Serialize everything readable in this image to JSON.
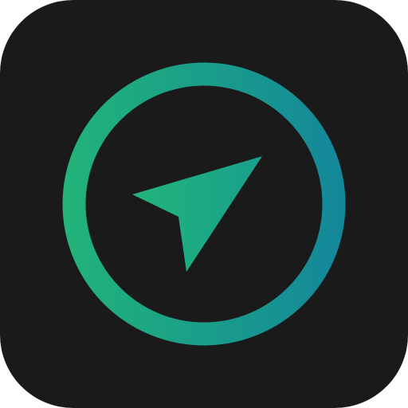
{
  "icon": {
    "semantic": "navigation-arrow-compass-icon",
    "background_color": "#1a1a1a",
    "gradient_start_color": "#22b479",
    "gradient_end_color": "#13879b"
  }
}
